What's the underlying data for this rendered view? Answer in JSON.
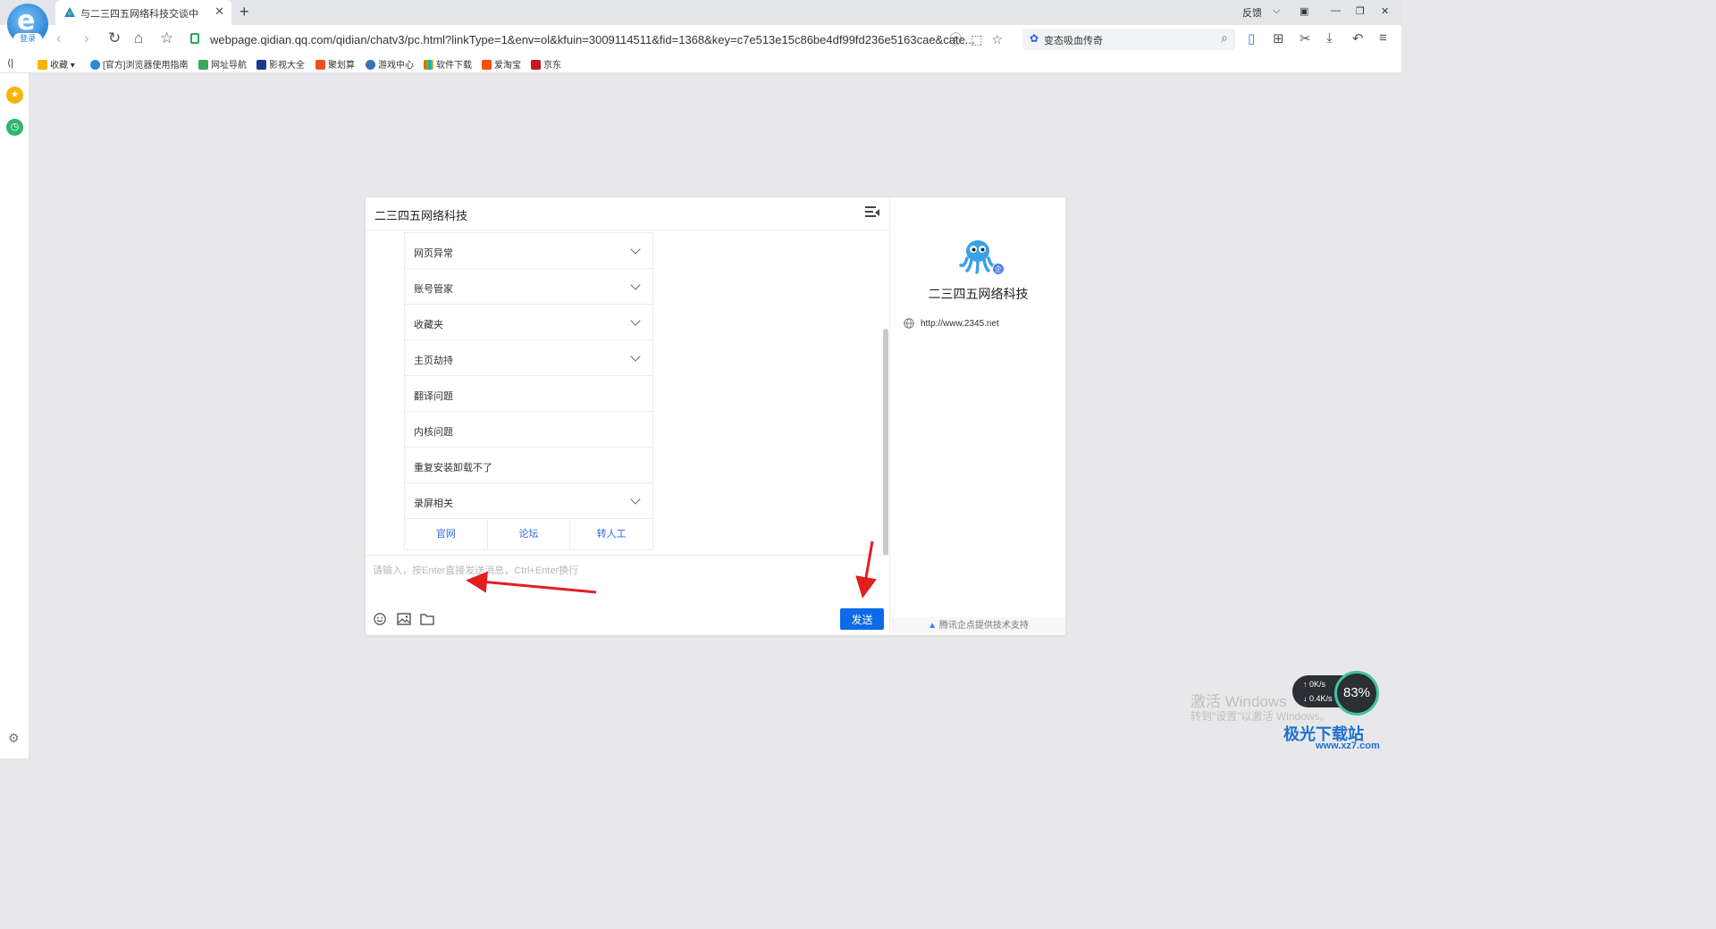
{
  "browser": {
    "logo_badge": "登录",
    "tab_title": "与二三四五网络科技交谈中",
    "url": "webpage.qidian.qq.com/qidian/chatv3/pc.html?linkType=1&env=ol&kfuin=3009114511&fid=1368&key=c7e513e15c86be4df99fd236e5163cae&cate...",
    "feedback": "反馈",
    "search_text": "变态吸血传奇",
    "bookmarks": [
      "收藏",
      "[官方]浏览器使用指南",
      "网址导航",
      "影视大全",
      "聚划算",
      "游戏中心",
      "软件下载",
      "爱淘宝",
      "京东"
    ]
  },
  "chat": {
    "title": "二三四五网络科技",
    "items": [
      {
        "label": "网页异常",
        "expandable": true
      },
      {
        "label": "账号管家",
        "expandable": true
      },
      {
        "label": "收藏夹",
        "expandable": true
      },
      {
        "label": "主页劫持",
        "expandable": true
      },
      {
        "label": "翻译问题",
        "expandable": false
      },
      {
        "label": "内核问题",
        "expandable": false
      },
      {
        "label": "重复安装卸载不了",
        "expandable": false
      },
      {
        "label": "录屏相关",
        "expandable": true
      }
    ],
    "links": [
      "官网",
      "论坛",
      "转人工"
    ],
    "input_placeholder": "请输入，按Enter直接发送消息，Ctrl+Enter换行",
    "send_label": "发送"
  },
  "profile": {
    "company": "二三四五网络科技",
    "badge": "企",
    "website": "http://www.2345.net",
    "support": "腾讯企点提供技术支持"
  },
  "overlay": {
    "watermark_title": "激活 Windows",
    "watermark_sub": "转到\"设置\"以激活 Windows。",
    "net_up": "0K/s",
    "net_down": "0.4K/s",
    "gauge": "83%",
    "site_logo": "极光下载站",
    "site_url": "www.xz7.com"
  },
  "colors": {
    "accent": "#0d6ae8",
    "link": "#2d6ae3",
    "annotation_arrow": "#e02020"
  }
}
